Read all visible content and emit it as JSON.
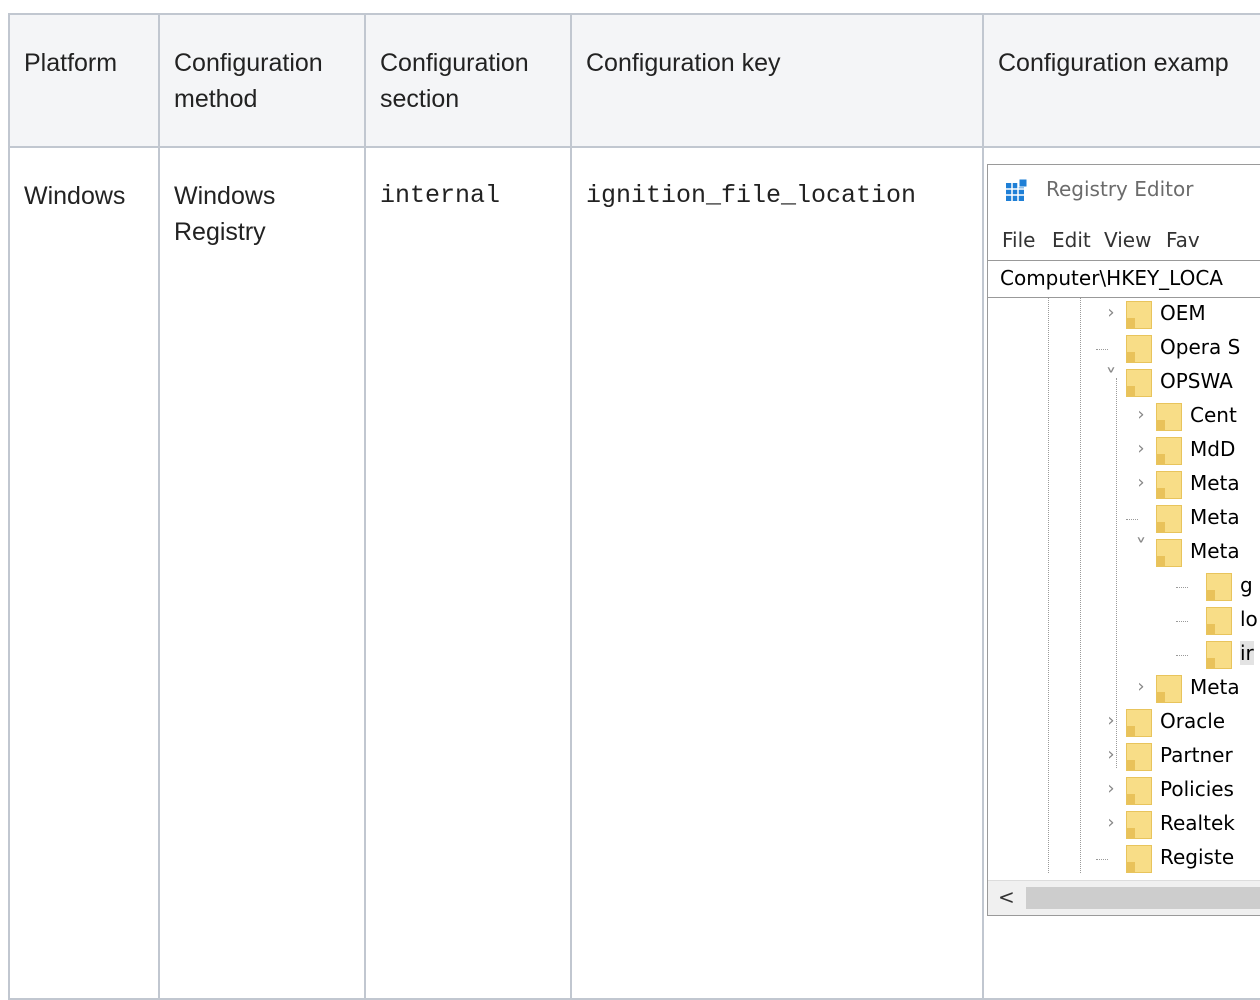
{
  "table": {
    "headers": [
      "Platform",
      "Configuration\nmethod",
      "Configuration\nsection",
      "Configuration key",
      "Configuration examp"
    ],
    "row": {
      "platform": "Windows",
      "method": "Windows\nRegistry",
      "section": "internal",
      "key": "ignition_file_location"
    }
  },
  "registry": {
    "title": "Registry Editor",
    "menu": [
      "File",
      "Edit",
      "View",
      "Fav"
    ],
    "address": "Computer\\HKEY_LOCA",
    "tree": [
      {
        "label": "OEM",
        "level": 0,
        "chevron": "right"
      },
      {
        "label": "Opera S",
        "level": 0,
        "chevron": "none"
      },
      {
        "label": "OPSWA",
        "level": 0,
        "chevron": "down"
      },
      {
        "label": "Cent",
        "level": 1,
        "chevron": "right"
      },
      {
        "label": "MdD",
        "level": 1,
        "chevron": "right"
      },
      {
        "label": "Meta",
        "level": 1,
        "chevron": "right"
      },
      {
        "label": "Meta",
        "level": 1,
        "chevron": "none"
      },
      {
        "label": "Meta",
        "level": 1,
        "chevron": "down"
      },
      {
        "label": "g",
        "level": 2,
        "chevron": "none"
      },
      {
        "label": "lo",
        "level": 2,
        "chevron": "none"
      },
      {
        "label": "ir",
        "level": 2,
        "chevron": "none",
        "selected": true
      },
      {
        "label": "Meta",
        "level": 1,
        "chevron": "right"
      },
      {
        "label": "Oracle",
        "level": 0,
        "chevron": "right"
      },
      {
        "label": "Partner",
        "level": 0,
        "chevron": "right"
      },
      {
        "label": "Policies",
        "level": 0,
        "chevron": "right"
      },
      {
        "label": "Realtek",
        "level": 0,
        "chevron": "right"
      },
      {
        "label": "Registe",
        "level": 0,
        "chevron": "none"
      }
    ],
    "scroll_left": "<"
  },
  "colors": {
    "border": "#c1c7d0",
    "header_bg": "#f4f5f7",
    "folder": "#f8dd87",
    "app_icon": "#1e7fd6"
  }
}
